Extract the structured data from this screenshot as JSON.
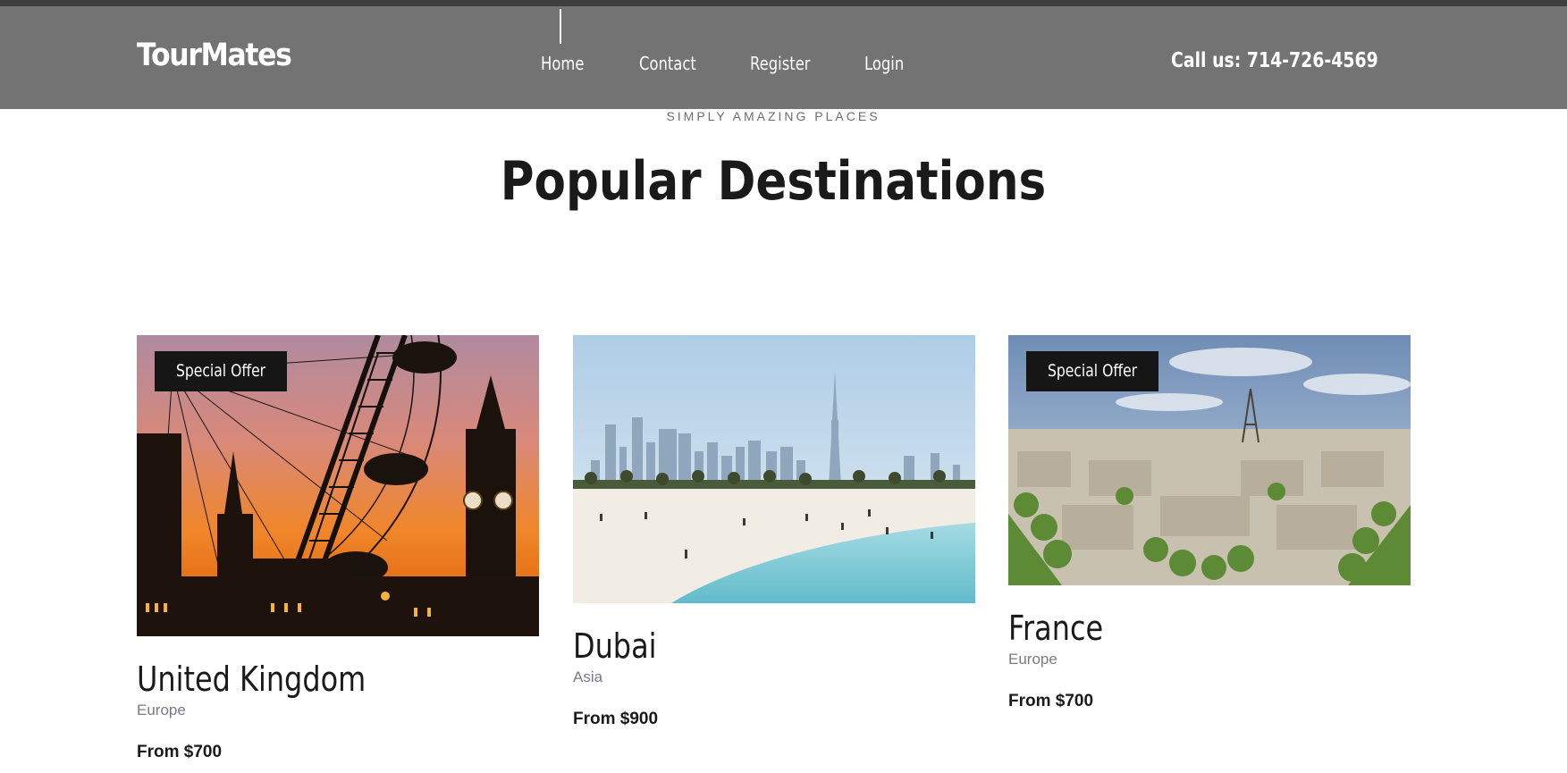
{
  "header": {
    "brand": "TourMates",
    "nav": [
      {
        "label": "Home"
      },
      {
        "label": "Contact"
      },
      {
        "label": "Register"
      },
      {
        "label": "Login"
      }
    ],
    "phone": "Call us: 714-726-4569"
  },
  "section": {
    "kicker": "SIMPLY AMAZING PLACES",
    "title": "Popular Destinations"
  },
  "destinations": [
    {
      "name": "United Kingdom",
      "region": "Europe",
      "price": "From $700",
      "badge": "Special Offer",
      "photo": "london-eye-big-ben-sunset-photo"
    },
    {
      "name": "Dubai",
      "region": "Asia",
      "price": "From $900",
      "badge": "",
      "photo": "dubai-skyline-beach-photo"
    },
    {
      "name": "France",
      "region": "Europe",
      "price": "From $700",
      "badge": "Special Offer",
      "photo": "paris-eiffel-tower-aerial-photo"
    }
  ],
  "colors": {
    "header_bg": "#737373",
    "header_top_border": "#3e3e3e",
    "badge_bg": "#161616",
    "kicker_text": "#6b6b7b",
    "region_text": "#7a7a86"
  }
}
